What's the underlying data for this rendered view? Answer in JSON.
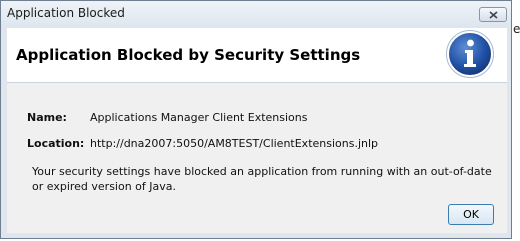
{
  "window": {
    "title": "Application Blocked",
    "stray_text": "e"
  },
  "header": {
    "title": "Application Blocked by Security Settings",
    "icon": "info-icon"
  },
  "details": {
    "name_label": "Name:",
    "name_value": "Applications Manager Client Extensions",
    "location_label": "Location:",
    "location_value": "http://dna2007:5050/AM8TEST/ClientExtensions.jnlp"
  },
  "message": "Your security settings have blocked an application from running with an out-of-date or expired version of Java.",
  "buttons": {
    "ok_label": "OK",
    "close_icon": "close-icon"
  },
  "colors": {
    "info_icon_blue": "#1f4fa3",
    "ok_border": "#3d7bad"
  }
}
